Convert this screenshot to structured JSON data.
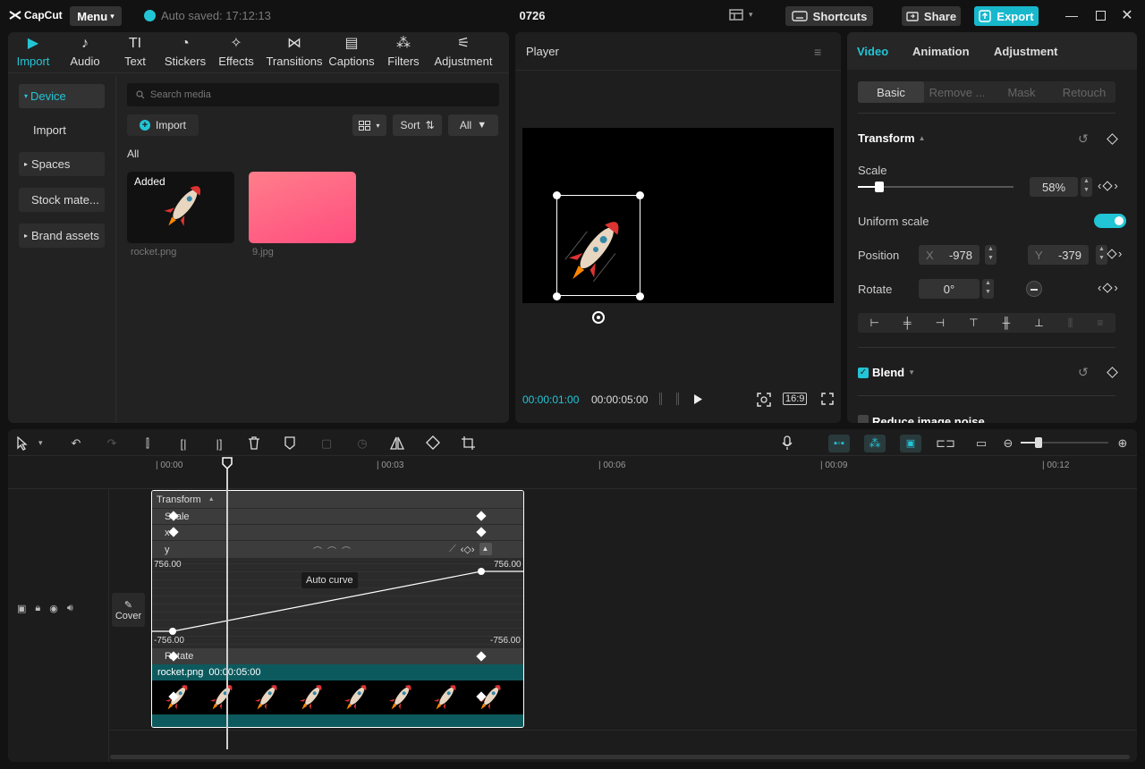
{
  "app": {
    "logo": "CapCut",
    "menu_label": "Menu",
    "autosave_text": "Auto saved: 17:12:13",
    "project_title": "0726",
    "shortcuts_label": "Shortcuts",
    "share_label": "Share",
    "export_label": "Export"
  },
  "media_tools": [
    {
      "label": "Import",
      "icon": "import-icon"
    },
    {
      "label": "Audio",
      "icon": "audio-icon"
    },
    {
      "label": "Text",
      "icon": "text-icon"
    },
    {
      "label": "Stickers",
      "icon": "stickers-icon"
    },
    {
      "label": "Effects",
      "icon": "effects-icon"
    },
    {
      "label": "Transitions",
      "icon": "transitions-icon"
    },
    {
      "label": "Captions",
      "icon": "captions-icon"
    },
    {
      "label": "Filters",
      "icon": "filters-icon"
    },
    {
      "label": "Adjustment",
      "icon": "adjustment-icon"
    }
  ],
  "sidebar": {
    "device": "Device",
    "import": "Import",
    "spaces": "Spaces",
    "stock": "Stock mate...",
    "brand": "Brand assets"
  },
  "media": {
    "search_placeholder": "Search media",
    "import_label": "Import",
    "sort_label": "Sort",
    "filter_label": "All",
    "section_label": "All",
    "items": [
      {
        "name": "rocket.png",
        "badge": "Added"
      },
      {
        "name": "9.jpg",
        "badge": ""
      }
    ]
  },
  "player": {
    "title": "Player",
    "current_time": "00:00:01:00",
    "total_time": "00:00:05:00",
    "ratio": "16:9"
  },
  "props": {
    "tabs": [
      "Video",
      "Animation",
      "Adjustment"
    ],
    "subtabs": [
      "Basic",
      "Remove ...",
      "Mask",
      "Retouch"
    ],
    "transform_label": "Transform",
    "scale_label": "Scale",
    "scale_value": "58%",
    "scale_fraction": 0.58,
    "uniform_scale_label": "Uniform scale",
    "uniform_scale_on": true,
    "position_label": "Position",
    "pos_x_label": "X",
    "pos_x": "-978",
    "pos_y_label": "Y",
    "pos_y": "-379",
    "rotate_label": "Rotate",
    "rotate_value": "0°",
    "blend_label": "Blend",
    "blend_checked": true,
    "reduce_noise_label": "Reduce image noise"
  },
  "timeline": {
    "ticks": [
      "00:00",
      "00:03",
      "00:06",
      "00:09",
      "00:12"
    ],
    "cover_label": "Cover",
    "transform_header": "Transform",
    "rows": {
      "scale": "Scale",
      "x": "x",
      "y": "y",
      "rotate": "Rotate"
    },
    "graph_top_left": "756.00",
    "graph_top_right": "756.00",
    "graph_bottom_left": "-756.00",
    "graph_bottom_right": "-756.00",
    "tooltip": "Auto curve",
    "clip_name": "rocket.png",
    "clip_duration": "00:00:05:00"
  },
  "colors": {
    "accent": "#22c5d6",
    "clip_teal": "#0d5a5e"
  }
}
